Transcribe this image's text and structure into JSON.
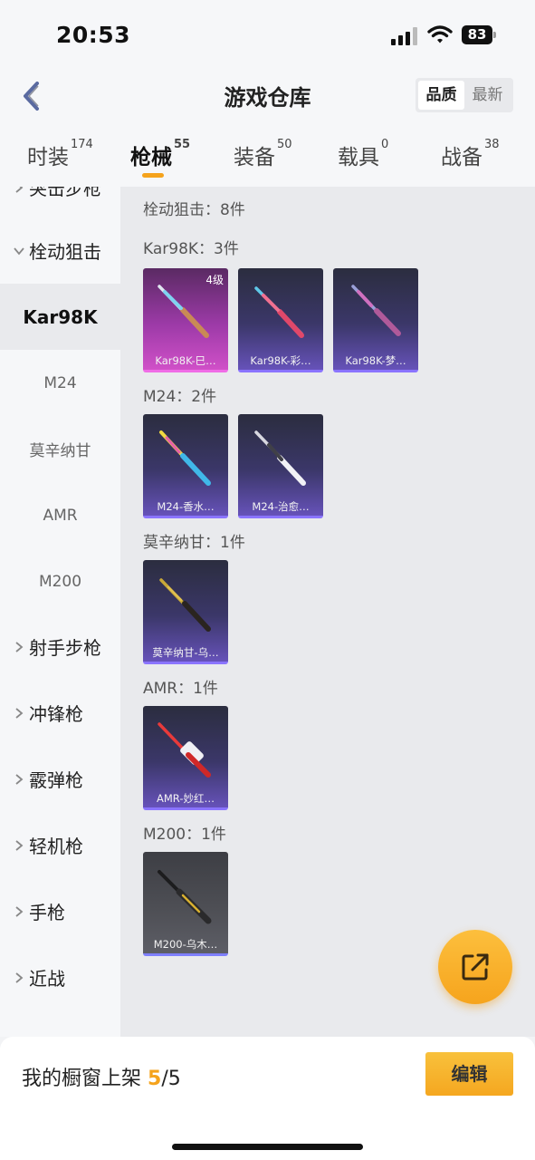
{
  "status": {
    "time": "20:53",
    "battery": "83"
  },
  "header": {
    "title": "游戏仓库",
    "sort_options": [
      "品质",
      "最新"
    ]
  },
  "tabs": [
    {
      "label": "时装",
      "count": "174"
    },
    {
      "label": "枪械",
      "count": "55"
    },
    {
      "label": "装备",
      "count": "50"
    },
    {
      "label": "载具",
      "count": "0"
    },
    {
      "label": "战备",
      "count": "38"
    }
  ],
  "sidebar": {
    "partial_top": "突击步枪",
    "category_expanded": "栓动狙击",
    "subitems": [
      "Kar98K",
      "M24",
      "莫辛纳甘",
      "AMR",
      "M200"
    ],
    "categories": [
      "射手步枪",
      "冲锋枪",
      "霰弹枪",
      "轻机枪",
      "手枪",
      "近战"
    ]
  },
  "content": {
    "summary": "栓动狙击：8件",
    "groups": [
      {
        "label": "Kar98K：3件",
        "items": [
          {
            "name": "Kar98K-巳…",
            "level": "4级"
          },
          {
            "name": "Kar98K-彩…"
          },
          {
            "name": "Kar98K-梦…"
          }
        ]
      },
      {
        "label": "M24：2件",
        "items": [
          {
            "name": "M24-香水…"
          },
          {
            "name": "M24-治愈…"
          }
        ]
      },
      {
        "label": "莫辛纳甘：1件",
        "items": [
          {
            "name": "莫辛纳甘-乌…"
          }
        ]
      },
      {
        "label": "AMR：1件",
        "items": [
          {
            "name": "AMR-妙红…"
          }
        ]
      },
      {
        "label": "M200：1件",
        "items": [
          {
            "name": "M200-乌木…"
          }
        ]
      }
    ]
  },
  "bottom": {
    "showcase_label": "我的橱窗上架",
    "showcase_count": "5",
    "showcase_total": "/5",
    "edit_label": "编辑"
  },
  "colors": {
    "accent": "#f5a31c",
    "card_purple": "#6652b9",
    "card_pink": "#d050c8"
  }
}
